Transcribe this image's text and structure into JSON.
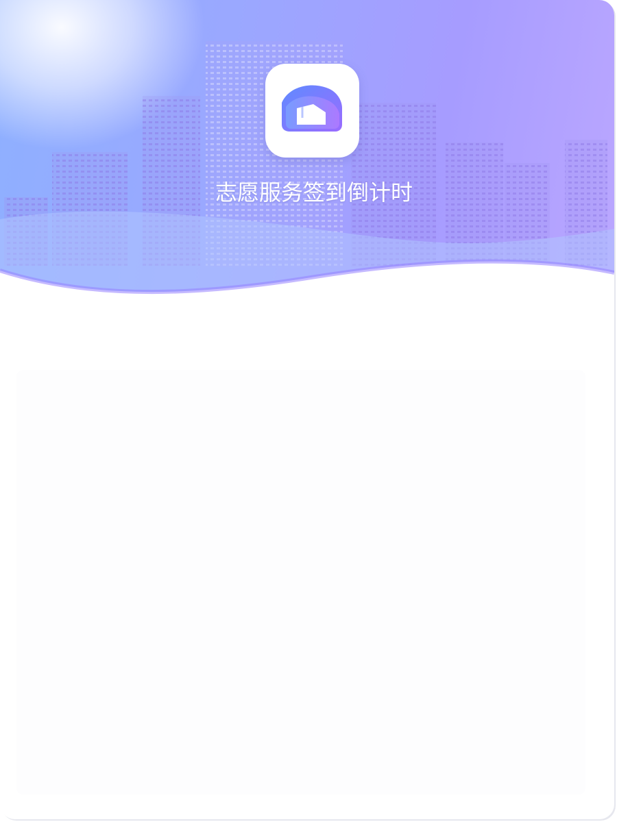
{
  "app": {
    "title": "志愿服务签到倒计时",
    "logo_icon": "volunteer-app-logo-icon"
  },
  "colors": {
    "banner_start": "#8eb0ff",
    "banner_end": "#bba7ff",
    "accent": "#8f7bff",
    "background": "#ffffff"
  },
  "content": {
    "state": "blank"
  }
}
